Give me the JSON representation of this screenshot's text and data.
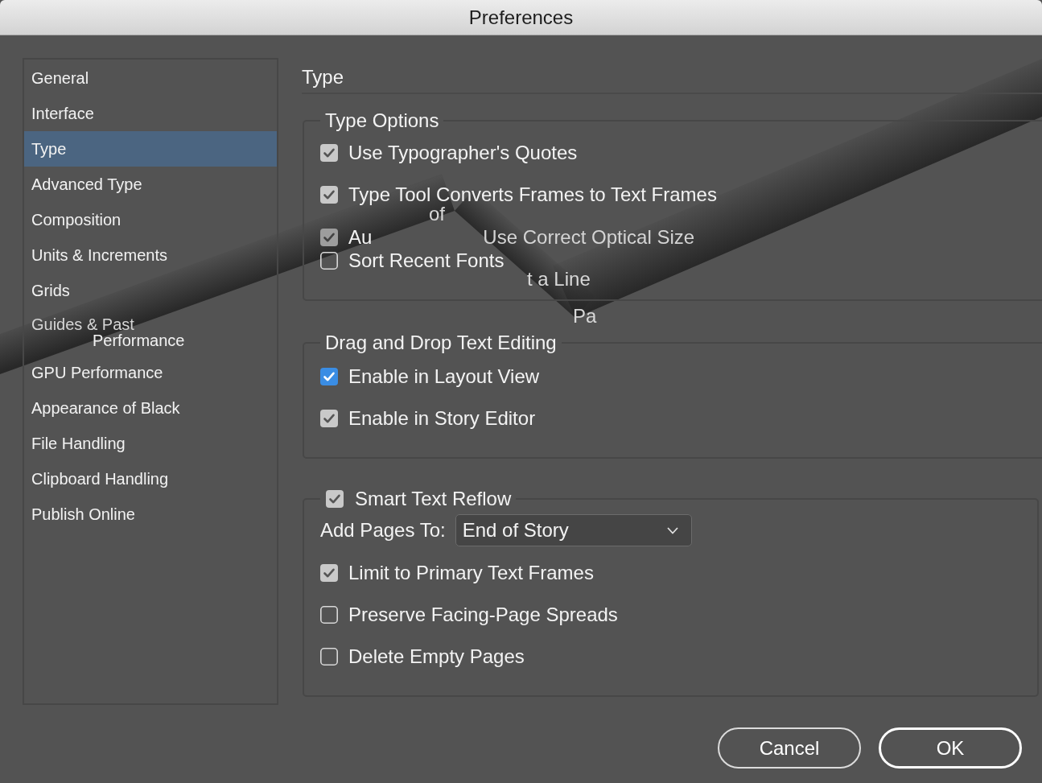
{
  "window": {
    "title": "Preferences"
  },
  "sidebar": {
    "items": [
      {
        "label": "General",
        "selected": false
      },
      {
        "label": "Interface",
        "selected": false
      },
      {
        "label": "Type",
        "selected": true
      },
      {
        "label": "Advanced Type",
        "selected": false
      },
      {
        "label": "Composition",
        "selected": false
      },
      {
        "label": "Units & Increments",
        "selected": false
      },
      {
        "label": "Grids",
        "selected": false
      },
      {
        "label": "Guides & Past",
        "selected": false
      },
      {
        "label": "Performance",
        "selected": false
      },
      {
        "label": "GPU Performance",
        "selected": false
      },
      {
        "label": "Appearance of Black",
        "selected": false
      },
      {
        "label": "File Handling",
        "selected": false
      },
      {
        "label": "Clipboard Handling",
        "selected": false
      },
      {
        "label": "Publish Online",
        "selected": false
      }
    ]
  },
  "page": {
    "title": "Type"
  },
  "sections": [
    {
      "kind": "group",
      "title": "Type Options",
      "items": [
        {
          "kind": "checkbox",
          "label": "Use Typographer's Quotes",
          "checked": true
        },
        {
          "kind": "checkbox",
          "label": "Type Tool Converts Frames to Text Frames",
          "checked": true
        },
        {
          "kind": "fragment",
          "label": "of"
        },
        {
          "kind": "split",
          "label": "Au",
          "trailing": "Use Correct Optical Size",
          "checked": true
        },
        {
          "kind": "checkbox",
          "label": "Sort Recent Fonts",
          "checked": false
        },
        {
          "kind": "fragment",
          "label": "t a Line"
        }
      ]
    },
    {
      "kind": "fragment",
      "text": "Pa"
    },
    {
      "kind": "group",
      "title": "Drag and Drop Text Editing",
      "items": [
        {
          "kind": "checkbox",
          "label": "Enable in Layout View",
          "checked": true,
          "focused": true
        },
        {
          "kind": "checkbox",
          "label": "Enable in Story Editor",
          "checked": true,
          "focused": false
        }
      ]
    },
    {
      "kind": "toggle_group",
      "title": "Smart Text Reflow",
      "checked": true,
      "field": {
        "label": "Add Pages To:",
        "value": "End of Story"
      },
      "items": [
        {
          "kind": "checkbox",
          "label": "Limit to Primary Text Frames",
          "checked": true
        },
        {
          "kind": "checkbox",
          "label": "Preserve Facing-Page Spreads",
          "checked": false
        },
        {
          "kind": "checkbox",
          "label": "Delete Empty Pages",
          "checked": false
        }
      ]
    }
  ],
  "buttons": [
    {
      "label": "Cancel",
      "default": false
    },
    {
      "label": "OK",
      "default": true
    }
  ]
}
